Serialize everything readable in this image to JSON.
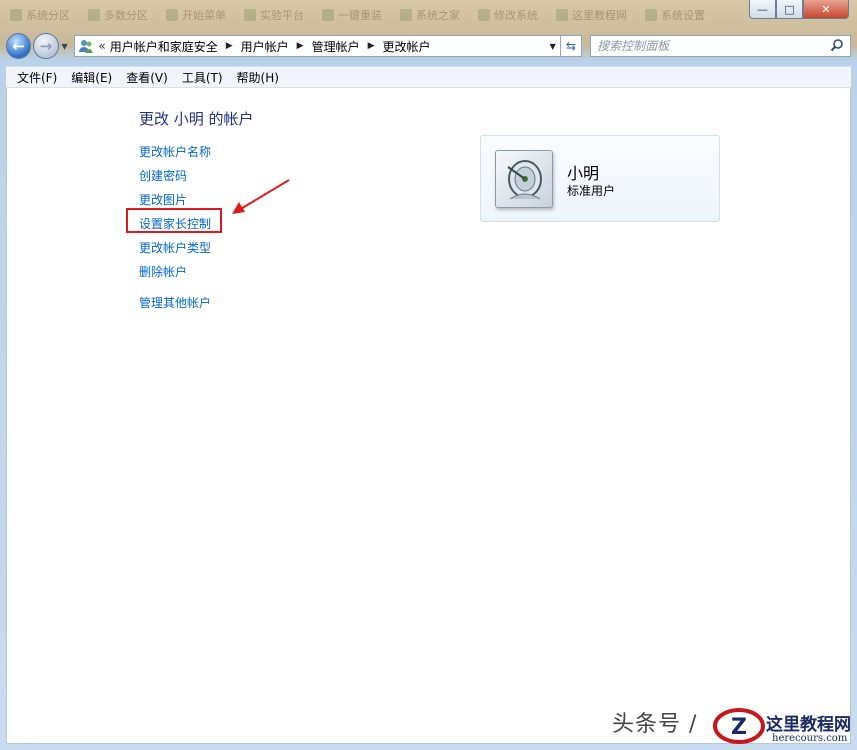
{
  "window": {
    "caption_buttons": {
      "minimize": "—",
      "maximize": "□",
      "close": "✕"
    }
  },
  "background_tabs": [
    "系统分区",
    "多数分区",
    "开始菜单",
    "实验平台",
    "一键重装",
    "系统之家",
    "修改系统",
    "这里教程网",
    "系统设置"
  ],
  "navbar": {
    "address_root_icon": "user-accounts-icon",
    "overflow_chevron": "«",
    "breadcrumbs": [
      "用户帐户和家庭安全",
      "用户帐户",
      "管理帐户",
      "更改帐户"
    ],
    "search_placeholder": "搜索控制面板"
  },
  "menubar": {
    "items": [
      "文件(F)",
      "编辑(E)",
      "查看(V)",
      "工具(T)",
      "帮助(H)"
    ]
  },
  "main": {
    "heading": "更改 小明 的帐户",
    "tasks": [
      "更改帐户名称",
      "创建密码",
      "更改图片",
      "设置家长控制",
      "更改帐户类型",
      "删除帐户"
    ],
    "other_task": "管理其他帐户",
    "highlighted_task_index": 3
  },
  "user_card": {
    "name": "小明",
    "type": "标准用户",
    "picture_icon": "satellite-dish-icon"
  },
  "colors": {
    "link": "#0066cc",
    "heading": "#1e3287",
    "highlight": "#e01818"
  },
  "watermark": {
    "prefix": "头条号 /",
    "site_name": "这里教程网",
    "site_url": "herecours.com"
  }
}
